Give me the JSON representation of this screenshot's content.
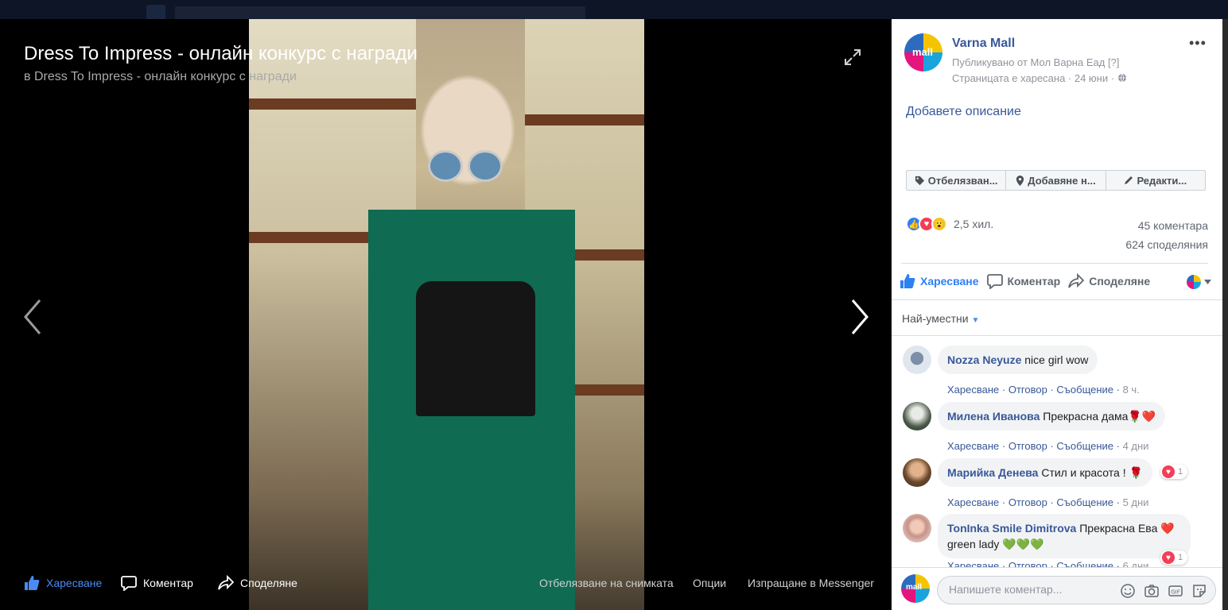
{
  "theater": {
    "title": "Dress To Impress - онлайн конкурс с награди",
    "subtitle": "в Dress To Impress - онлайн конкурс с награди",
    "bottom": {
      "like": "Харесване",
      "comment": "Коментар",
      "share": "Споделяне",
      "tag": "Отбелязване на снимката",
      "options": "Опции",
      "messenger": "Изпращане в Messenger"
    }
  },
  "post": {
    "page_name": "Varna Mall",
    "avatar_text": "mall",
    "published_by": "Публикувано от Мол Варна Еад",
    "help": "[?]",
    "liked_line": "Страницата е харесана · 24 юни ·",
    "add_description": "Добавете описание",
    "actions": [
      "Отбелязван...",
      "Добавяне н...",
      "Редакти..."
    ],
    "reactions_count": "2,5 хил.",
    "comments_count": "45 коментара",
    "shares_count": "624 споделяния",
    "ufi": {
      "like": "Харесване",
      "comment": "Коментар",
      "share": "Споделяне"
    },
    "sort_label": "Най-уместни"
  },
  "comments": [
    {
      "name": "Nozza Neyuze",
      "text": "nice girl wow",
      "time": "8 ч."
    },
    {
      "name": "Милена Иванова",
      "text": "Прекрасна дама🌹❤️",
      "time": "4 дни"
    },
    {
      "name": "Марийка Денева",
      "text": "Стил и красота ! 🌹",
      "time": "5 дни",
      "reactions": "1"
    },
    {
      "name": "TonInka Smile Dimitrova",
      "text": "Прекрасна Ева ❤️ green lady 💚💚💚",
      "time": "6 дни",
      "reactions": "1"
    }
  ],
  "comment_actions": {
    "like": "Харесване",
    "reply": "Отговор",
    "message": "Съобщение"
  },
  "compose": {
    "placeholder": "Напишете коментар..."
  },
  "colors": {
    "link": "#385898",
    "like_blue": "#2e80f5",
    "suit_green": "#0f6b52"
  }
}
